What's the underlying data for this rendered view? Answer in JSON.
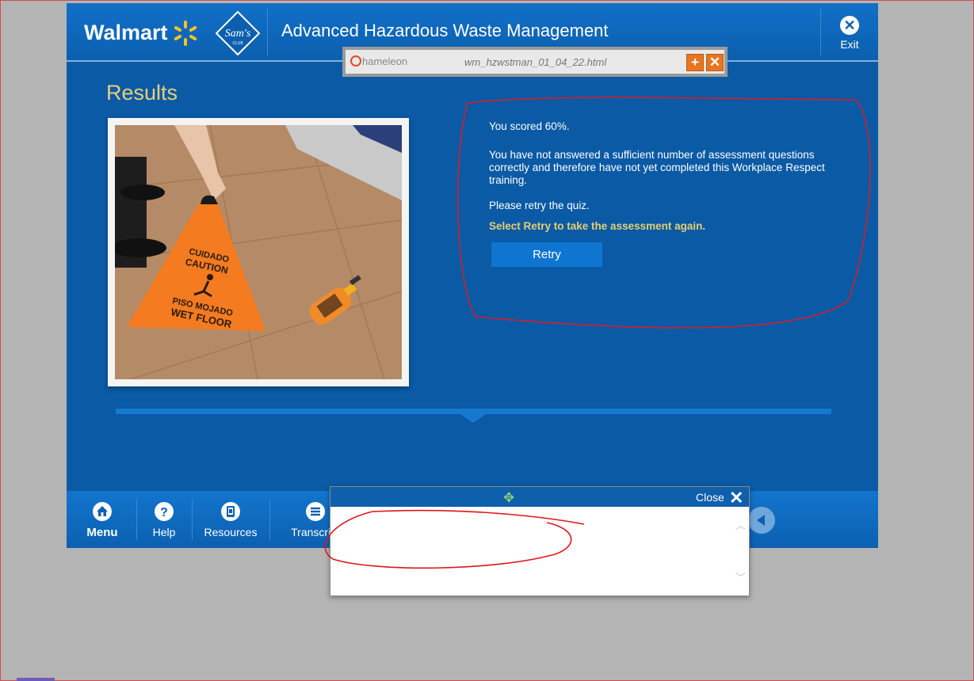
{
  "header": {
    "brand_walmart": "Walmart",
    "brand_sams": "Sam's",
    "brand_sams_sub": "CLUB",
    "course_title": "Advanced Hazardous Waste Management",
    "exit_label": "Exit"
  },
  "chameleon_bar": {
    "logo_text": "hameleon",
    "file_name": "wm_hzwstman_01_04_22.html"
  },
  "main": {
    "heading": "Results",
    "photo": {
      "sign_line1": "CUIDADO",
      "sign_line2": "CAUTION",
      "sign_line3": "PISO MOJADO",
      "sign_line4": "WET FLOOR"
    },
    "score_text": "You scored 60%.",
    "message": "You have not answered a sufficient number of assessment questions correctly and therefore have not yet completed this Workplace Respect training.",
    "retry_prompt": "Please retry the quiz.",
    "retry_instruction": "Select Retry to take the assessment again.",
    "retry_button": "Retry",
    "progress_fraction": 1.0
  },
  "footer": {
    "nav": [
      {
        "label": "Menu",
        "icon": "home-icon"
      },
      {
        "label": "Help",
        "icon": "question-icon"
      },
      {
        "label": "Resources",
        "icon": "document-icon"
      },
      {
        "label": "Transcript",
        "icon": "list-icon"
      }
    ]
  },
  "popup": {
    "close_label": "Close"
  },
  "colors": {
    "app_blue": "#0b5aa5",
    "header_blue": "#1170c8",
    "gold": "#e7cf7a",
    "retry_button": "#0e76d1",
    "annotation_red": "#d21e2a"
  }
}
